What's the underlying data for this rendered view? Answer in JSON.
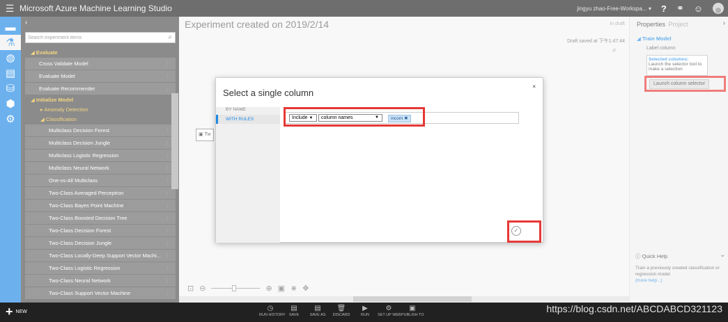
{
  "app": {
    "title": "Microsoft Azure Machine Learning Studio",
    "workspace": "jingyu zhao-Free-Workspa...",
    "workspace_caret": "▾",
    "help_icon": "question-icon",
    "help_glyph": "?",
    "community_glyph": "⚭",
    "smile_glyph": "☺"
  },
  "palette": {
    "search_placeholder": "Search experiment items",
    "groups": {
      "evaluate": "Evaluate",
      "initialize": "Initialize Model",
      "anomaly": "Anomaly Detection",
      "classification": "Classification"
    },
    "evaluate_items": [
      "Cross Validate Model",
      "Evaluate Model",
      "Evaluate Recommender"
    ],
    "classification_items": [
      "Multiclass Decision Forest",
      "Multiclass Decision Jungle",
      "Multiclass Logistic Regression",
      "Multiclass Neural Network",
      "One-vs-All Multiclass",
      "Two-Class Averaged Perceptron",
      "Two-Class Bayes Point Machine",
      "Two-Class Boosted Decision Tree",
      "Two-Class Decision Forest",
      "Two-Class Decision Jungle",
      "Two-Class Locally-Deep Support Vector Machi...",
      "Two-Class Logistic Regression",
      "Two-Class Neural Network",
      "Two-Class Support Vector Machine"
    ]
  },
  "canvas": {
    "experiment_title": "Experiment created on 2019/2/14",
    "status": "In draft",
    "draft_saved": "Draft saved at 下午1:47:44",
    "module_label": "Tw"
  },
  "properties": {
    "tab_properties": "Properties",
    "tab_project": "Project",
    "section": "Train Model",
    "label_column": "Label column",
    "selected_title": "Selected columns:",
    "selected_hint": "Launch the selector tool to make a selection",
    "launch_button": "Launch column selector",
    "quick_help": "Quick Help",
    "quick_help_text": "Train a previously created classification or regression model",
    "more_help": "(more help...)"
  },
  "modal": {
    "title": "Select a single column",
    "close": "×",
    "modes": [
      "BY NAME",
      "WITH RULES"
    ],
    "rule_include": "Include",
    "rule_type": "column names",
    "tag": "incom",
    "confirm_glyph": "✓"
  },
  "bottom": {
    "new_label": "NEW",
    "actions": [
      {
        "label": "RUN HISTORY",
        "glyph": "◷"
      },
      {
        "label": "SAVE",
        "glyph": "▤"
      },
      {
        "label": "SAVE AS",
        "glyph": "▤"
      },
      {
        "label": "DISCARD",
        "glyph": "🗑"
      },
      {
        "label": "RUN",
        "glyph": "▶"
      },
      {
        "label": "SET UP WEB",
        "glyph": "⚙"
      },
      {
        "label": "PUBLISH TO",
        "glyph": "▣"
      }
    ],
    "watermark": "https://blog.csdn.net/ABCDABCD321123"
  }
}
